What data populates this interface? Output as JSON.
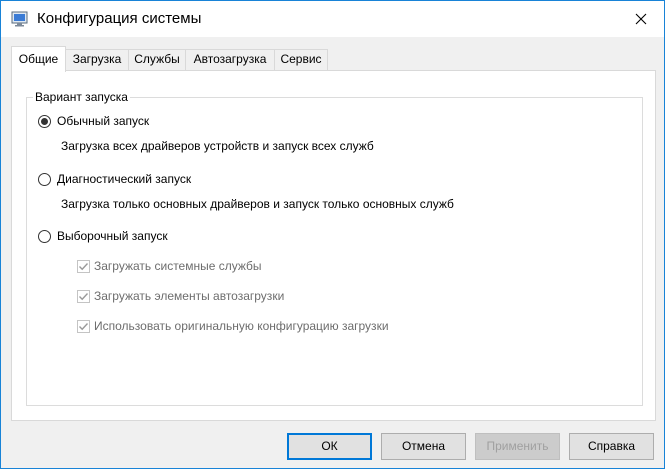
{
  "window": {
    "title": "Конфигурация системы",
    "icon": "msconfig-icon",
    "accent_color": "#0078d7"
  },
  "tabs": [
    {
      "label": "Общие",
      "active": true
    },
    {
      "label": "Загрузка",
      "active": false
    },
    {
      "label": "Службы",
      "active": false
    },
    {
      "label": "Автозагрузка",
      "active": false
    },
    {
      "label": "Сервис",
      "active": false
    }
  ],
  "startup": {
    "group_label": "Вариант запуска",
    "options": [
      {
        "label": "Обычный запуск",
        "description": "Загрузка всех драйверов устройств и запуск всех служб",
        "selected": true
      },
      {
        "label": "Диагностический запуск",
        "description": "Загрузка только основных драйверов и запуск только основных служб",
        "selected": false
      },
      {
        "label": "Выборочный запуск",
        "selected": false
      }
    ],
    "selective_checks": [
      {
        "label": "Загружать системные службы",
        "checked": true,
        "enabled": false
      },
      {
        "label": "Загружать элементы автозагрузки",
        "checked": true,
        "enabled": false
      },
      {
        "label": "Использовать оригинальную конфигурацию загрузки",
        "checked": true,
        "enabled": false
      }
    ]
  },
  "buttons": {
    "ok": "ОК",
    "cancel": "Отмена",
    "apply": "Применить",
    "help": "Справка"
  }
}
